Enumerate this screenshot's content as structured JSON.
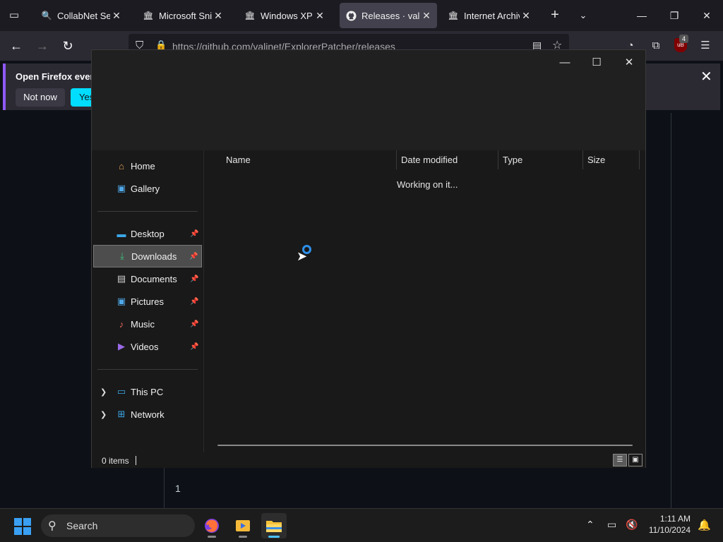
{
  "browser": {
    "tabs": [
      {
        "label": "CollabNet SearX",
        "icon": "search-icon",
        "active": false
      },
      {
        "label": "Microsoft Snip &",
        "icon": "archive-icon",
        "active": false
      },
      {
        "label": "Windows XP Pro",
        "icon": "archive-icon",
        "active": false
      },
      {
        "label": "Releases · valinet",
        "icon": "github-icon",
        "active": true
      },
      {
        "label": "Internet Archive",
        "icon": "archive-icon",
        "active": false
      }
    ],
    "url": "https://github.com/valinet/ExplorerPatcher/releases",
    "ublock_count": "4"
  },
  "notification": {
    "title": "Open Firefox every",
    "not_now": "Not now",
    "yes": "Yes"
  },
  "page": {
    "page_number": "1"
  },
  "explorer": {
    "nav": {
      "home": "Home",
      "gallery": "Gallery",
      "desktop": "Desktop",
      "downloads": "Downloads",
      "documents": "Documents",
      "pictures": "Pictures",
      "music": "Music",
      "videos": "Videos",
      "this_pc": "This PC",
      "network": "Network"
    },
    "columns": {
      "name": "Name",
      "date_modified": "Date modified",
      "type": "Type",
      "size": "Size"
    },
    "loading_text": "Working on it...",
    "status": "0 items"
  },
  "taskbar": {
    "search_label": "Search",
    "time": "1:11 AM",
    "date": "11/10/2024"
  }
}
